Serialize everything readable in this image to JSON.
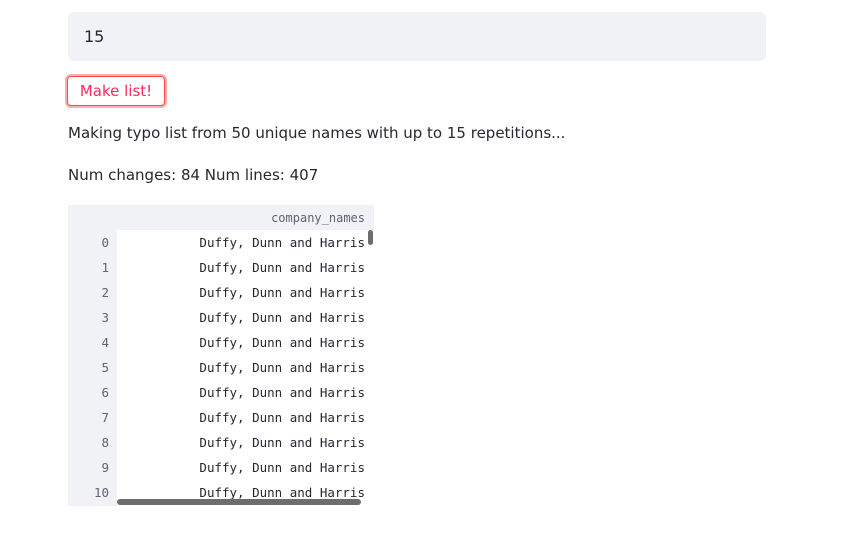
{
  "number_input": {
    "value": "15"
  },
  "make_button": {
    "label": "Make list!"
  },
  "status_text": "Making typo list from 50 unique names with up to 15 repetitions...",
  "stats_text": "Num changes: 84 Num lines: 407",
  "dataframe": {
    "column_header": "company_names",
    "rows": [
      {
        "index": "0",
        "value": "Duffy, Dunn and Harris"
      },
      {
        "index": "1",
        "value": "Duffy, Dunn and Harris"
      },
      {
        "index": "2",
        "value": "Duffy, Dunn and Harris"
      },
      {
        "index": "3",
        "value": "Duffy, Dunn and Harris"
      },
      {
        "index": "4",
        "value": "Duffy, Dunn and Harris"
      },
      {
        "index": "5",
        "value": "Duffy, Dunn and Harris"
      },
      {
        "index": "6",
        "value": "Duffy, Dunn and Harris"
      },
      {
        "index": "7",
        "value": "Duffy, Dunn and Harris"
      },
      {
        "index": "8",
        "value": "Duffy, Dunn and Harris"
      },
      {
        "index": "9",
        "value": "Duffy, Dunn and Harris"
      },
      {
        "index": "10",
        "value": "Duffy, Dunn and Harris"
      }
    ]
  },
  "colors": {
    "accent": "#ff4b4b",
    "button_text": "#ff2b5e",
    "input_bg": "#f0f2f6",
    "text": "#262730",
    "muted_text": "#5c6373",
    "scrollbar": "#6d6d6d"
  }
}
